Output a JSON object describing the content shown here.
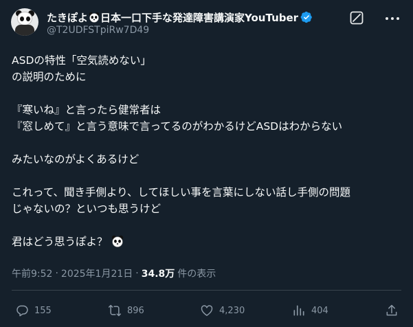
{
  "author": {
    "display_name_prefix": "たきぽよ",
    "display_name_suffix": "日本一口下手な発達障害講演家YouTuber",
    "handle": "@T2UDFSTpiRw7D49"
  },
  "tweet": {
    "line1": "ASDの特性「空気読めない」",
    "line2": "の説明のために",
    "line3": "『寒いね』と言ったら健常者は",
    "line4": "『窓しめて』と言う意味で言ってるのがわかるけどASDはわからない",
    "line5": "みたいなのがよくあるけど",
    "line6": "これって、聞き手側より、してほしい事を言葉にしない話し手側の問題",
    "line7": "じゃないの？といつも思うけど",
    "line8": "君はどう思うぽよ？"
  },
  "meta": {
    "time": "午前9:52",
    "separator1": "·",
    "date": "2025年1月21日",
    "separator2": "·",
    "views_count": "34.8万",
    "views_label": "件の表示"
  },
  "actions": {
    "replies": "155",
    "reposts": "896",
    "likes": "4,230",
    "bookmarks": "404"
  },
  "colors": {
    "background": "#15202b",
    "text": "#f7f9f9",
    "secondary": "#8b98a5",
    "verified": "#1d9bf0",
    "divider": "#38444d"
  },
  "icons": [
    "panda-emoji-icon",
    "verified-badge-icon",
    "grok-icon",
    "more-icon",
    "reply-icon",
    "repost-icon",
    "like-icon",
    "bookmark-icon",
    "share-icon"
  ]
}
